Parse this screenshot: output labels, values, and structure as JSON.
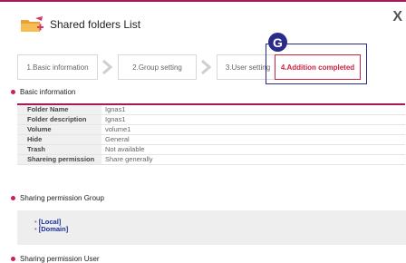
{
  "window": {
    "title": "Shared folders List",
    "close_label": "X"
  },
  "steps": [
    {
      "label": "1.Basic information",
      "active": false
    },
    {
      "label": "2.Group setting",
      "active": false
    },
    {
      "label": "3.User setting",
      "active": false
    },
    {
      "label": "4.Addition completed",
      "active": true
    }
  ],
  "marker": {
    "label": "G"
  },
  "sections": {
    "basic": "Basic information",
    "group": "Sharing permission Group",
    "user": "Sharing permission User"
  },
  "info_rows": [
    {
      "label": "Folder Name",
      "value": "Ignas1"
    },
    {
      "label": "Folder description",
      "value": "Ignas1"
    },
    {
      "label": "Volume",
      "value": "volume1"
    },
    {
      "label": "Hide",
      "value": "General"
    },
    {
      "label": "Trash",
      "value": "Not available"
    },
    {
      "label": "Shareing permission",
      "value": "Share generally"
    }
  ],
  "groups": [
    "[Local]",
    "[Domain]"
  ],
  "colors": {
    "accent": "#a8185a",
    "active_step": "#cc2244",
    "marker": "#2a2a8a",
    "link": "#1a2fa0"
  }
}
